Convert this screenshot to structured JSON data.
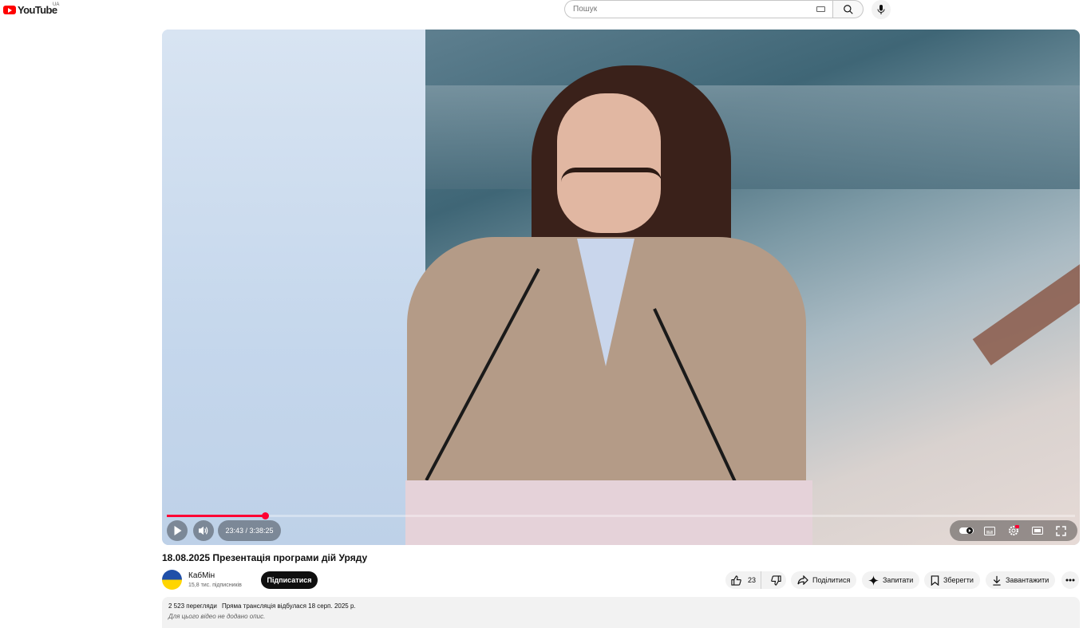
{
  "header": {
    "logo_text": "YouTube",
    "region": "UA",
    "search_placeholder": "Пошук"
  },
  "player": {
    "current_time": "23:43",
    "duration": "3:38:25",
    "time_display": "23:43 / 3:38:25",
    "progress_fraction": 0.1085,
    "accent_color": "#ff0033"
  },
  "video": {
    "title": "18.08.2025 Презентація програми дій Уряду",
    "channel_name": "КабМін",
    "subscribers": "15,8 тис. підписників",
    "subscribe_label": "Підписатися",
    "likes": "23",
    "share_label": "Поділитися",
    "ask_label": "Запитати",
    "save_label": "Зберегти",
    "download_label": "Завантажити"
  },
  "description": {
    "views": "2 523 перегляди",
    "stream_info": "Пряма трансляція відбулася 18 серп. 2025 р.",
    "text": "Для цього відео не додано опис."
  }
}
